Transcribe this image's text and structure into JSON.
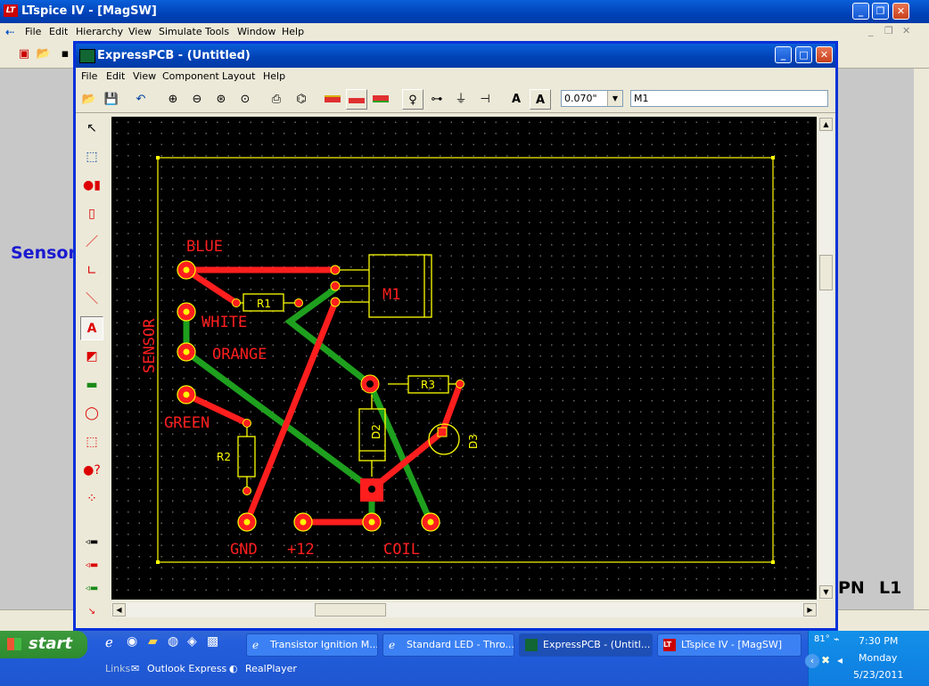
{
  "ltspice": {
    "title": "LTspice IV - [MagSW]",
    "menu": [
      "File",
      "Edit",
      "Hierarchy",
      "View",
      "Simulate",
      "Tools",
      "Window",
      "Help"
    ],
    "schematic_labels": {
      "sensor": "Sensor",
      "npn": "PN",
      "l1": "L1"
    }
  },
  "expresspcb": {
    "title": "ExpressPCB - (Untitled)",
    "menu": [
      "File",
      "Edit",
      "View",
      "Component",
      "Layout",
      "Help"
    ],
    "trace_width": "0.070\"",
    "label_text": "M1",
    "board": {
      "labels": {
        "blue": "BLUE",
        "white": "WHITE",
        "orange": "ORANGE",
        "green": "GREEN",
        "sensor": "SENSOR",
        "gnd": "GND",
        "plus12": "+12",
        "coil": "COIL"
      },
      "components": {
        "m1": "M1",
        "r1": "R1",
        "r2": "R2",
        "r3": "R3",
        "d2": "D2",
        "d3": "D3"
      },
      "colors": {
        "top_copper": "#ff1e1e",
        "bottom_copper": "#1ea01e",
        "silkscreen": "#ffff00",
        "background": "#000000"
      }
    }
  },
  "taskbar": {
    "start": "start",
    "tasks": [
      {
        "label": "Transistor Ignition M...",
        "icon": "ie-icon"
      },
      {
        "label": "Standard LED - Thro...",
        "icon": "ie-icon"
      },
      {
        "label": "ExpressPCB - (Untitl...",
        "icon": "expresspcb-icon"
      },
      {
        "label": "LTspice IV - [MagSW]",
        "icon": "ltspice-icon"
      }
    ],
    "quicklaunch": {
      "links": "Links",
      "outlook": "Outlook Express",
      "realplayer": "RealPlayer"
    },
    "clock": {
      "time": "7:30 PM",
      "day": "Monday",
      "date": "5/23/2011"
    },
    "temperature": "81°"
  }
}
